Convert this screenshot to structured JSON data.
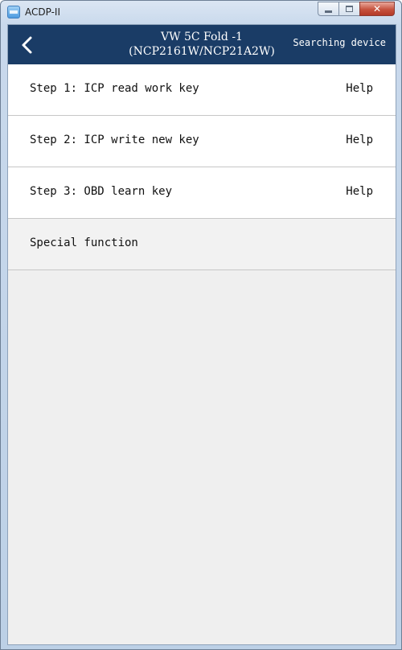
{
  "window": {
    "title": "ACDP-II",
    "close_glyph": "✕"
  },
  "header": {
    "title_line1": "VW 5C Fold -1",
    "title_line2": "(NCP2161W/NCP21A2W)",
    "status": "Searching device",
    "background_color": "#1a3c66"
  },
  "menu": {
    "items": [
      {
        "label": "Step 1: ICP read work key",
        "help": "Help"
      },
      {
        "label": "Step 2: ICP write new key",
        "help": "Help"
      },
      {
        "label": "Step 3: OBD learn key",
        "help": "Help"
      },
      {
        "label": "Special function"
      }
    ]
  }
}
